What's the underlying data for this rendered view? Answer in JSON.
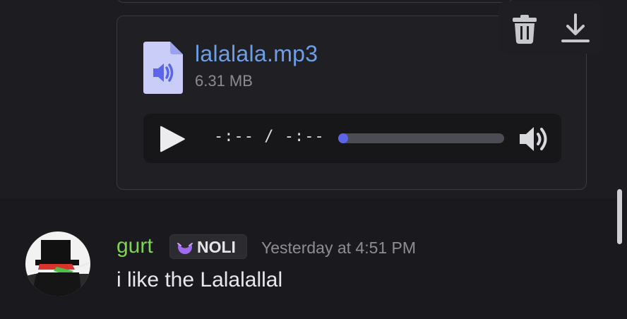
{
  "attachment": {
    "file_name": "lalalala.mp3",
    "file_size": "6.31 MB",
    "file_icon": "audio-file-icon"
  },
  "player": {
    "time_display": "-:-- / -:--",
    "progress_fraction": 0,
    "play_icon": "play-icon",
    "volume_icon": "volume-icon"
  },
  "hover_toolbar": {
    "delete_icon": "trash-icon",
    "download_icon": "download-icon"
  },
  "message": {
    "username": "gurt",
    "tag": "NOLI",
    "timestamp": "Yesterday at 4:51 PM",
    "text": "i like the Lalalallal",
    "username_color": "#7fd44f"
  },
  "colors": {
    "accent": "#5a65ea",
    "link": "#6c9fe8",
    "background": "#1a1a1e"
  }
}
